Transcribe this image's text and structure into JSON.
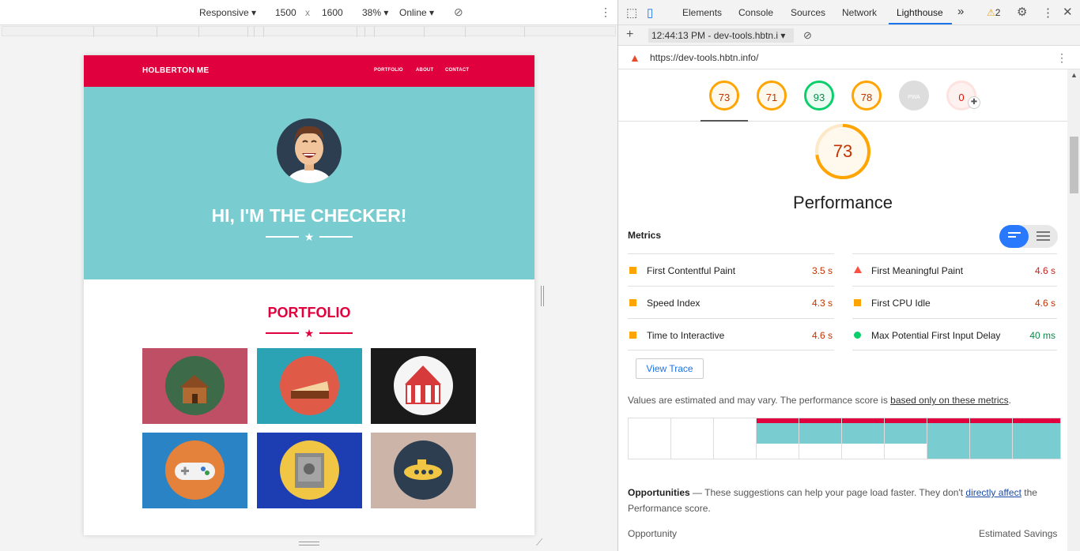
{
  "device_toolbar": {
    "device": "Responsive",
    "width": "1500",
    "times": "x",
    "height": "1600",
    "zoom": "38%",
    "throttle": "Online"
  },
  "site": {
    "brand": "HOLBERTON ME",
    "nav": [
      "PORTFOLIO",
      "ABOUT",
      "CONTACT"
    ],
    "hero_title": "HI, I'M THE CHECKER!",
    "portfolio_title": "PORTFOLIO",
    "colors": {
      "header": "#e0003d",
      "hero": "#79cdd0"
    },
    "tiles": [
      {
        "name": "cabin",
        "bg": "#bf4f64",
        "circle": "#3d6b4a"
      },
      {
        "name": "cake",
        "bg": "#2ba3b4",
        "circle": "#e05a48"
      },
      {
        "name": "circus",
        "bg": "#1a1a1a",
        "circle": "#f5f5f5"
      },
      {
        "name": "game-controller",
        "bg": "#2a83c4",
        "circle": "#e4813a"
      },
      {
        "name": "safe",
        "bg": "#1d3db3",
        "circle": "#f2c645"
      },
      {
        "name": "submarine",
        "bg": "#ccb4a8",
        "circle": "#2c3e50"
      }
    ]
  },
  "devtools": {
    "tabs": [
      "Elements",
      "Console",
      "Sources",
      "Network",
      "Lighthouse"
    ],
    "more": "»",
    "warnings": "2",
    "report_time": "12:44:13 PM - dev-tools.hbtn.i",
    "url": "https://dev-tools.hbtn.info/",
    "scores": [
      "73",
      "71",
      "93",
      "78",
      "PWA",
      "0"
    ],
    "performance_score": "73",
    "performance_label": "Performance",
    "metrics_heading": "Metrics",
    "metrics": [
      {
        "label": "First Contentful Paint",
        "value": "3.5 s",
        "status": "average"
      },
      {
        "label": "First Meaningful Paint",
        "value": "4.6 s",
        "status": "fail"
      },
      {
        "label": "Speed Index",
        "value": "4.3 s",
        "status": "average"
      },
      {
        "label": "First CPU Idle",
        "value": "4.6 s",
        "status": "fail"
      },
      {
        "label": "Time to Interactive",
        "value": "4.6 s",
        "status": "average"
      },
      {
        "label": "Max Potential First Input Delay",
        "value": "40 ms",
        "status": "pass"
      }
    ],
    "view_trace": "View Trace",
    "note_prefix": "Values are estimated and may vary. The performance score is ",
    "note_link": "based only on these metrics",
    "note_suffix": ".",
    "opp_title": "Opportunities",
    "opp_text_a": " — These suggestions can help your page load faster. They don't ",
    "opp_link": "directly affect",
    "opp_text_b": " the Performance score.",
    "opp_col_left": "Opportunity",
    "opp_col_right": "Estimated Savings",
    "colors": {
      "average": "#ffa400",
      "fail": "#ff4e42",
      "pass": "#0cce6b",
      "link": "#1a73e8"
    }
  }
}
